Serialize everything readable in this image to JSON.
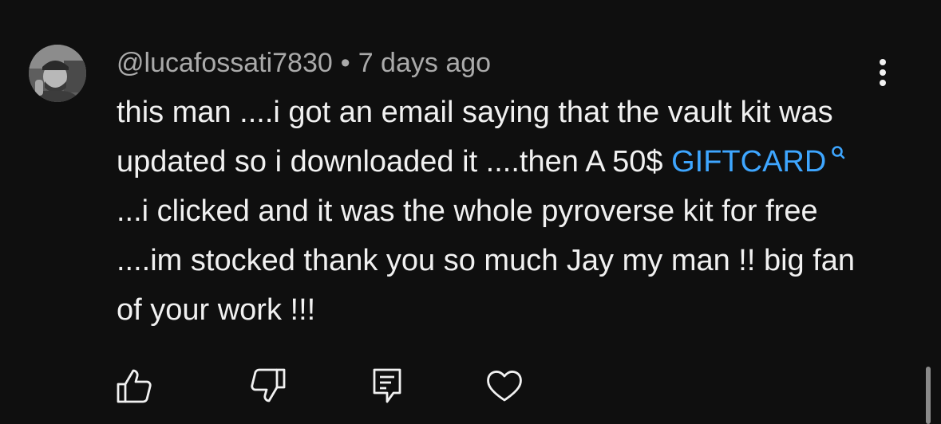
{
  "comment": {
    "author": "@lucafossati7830",
    "separator": "•",
    "timestamp": "7 days ago",
    "text_before_link": "this man ....i got an email saying that the vault kit was updated so i downloaded it ....then A 50$ ",
    "link_text": "GIFTCARD",
    "text_after_link": "...i clicked and it was the whole pyroverse kit for free ....im stocked thank you so much Jay my man !! big fan of your work !!!"
  },
  "icons": {
    "avatar": "avatar-photo",
    "menu": "more-vertical-icon",
    "link_search": "search-icon",
    "like": "thumbs-up-icon",
    "dislike": "thumbs-down-icon",
    "reply": "reply-icon",
    "heart": "heart-icon"
  },
  "colors": {
    "background": "#0f0f0f",
    "text": "#f1f1f1",
    "meta": "#aaaaaa",
    "link": "#3ea6ff"
  }
}
